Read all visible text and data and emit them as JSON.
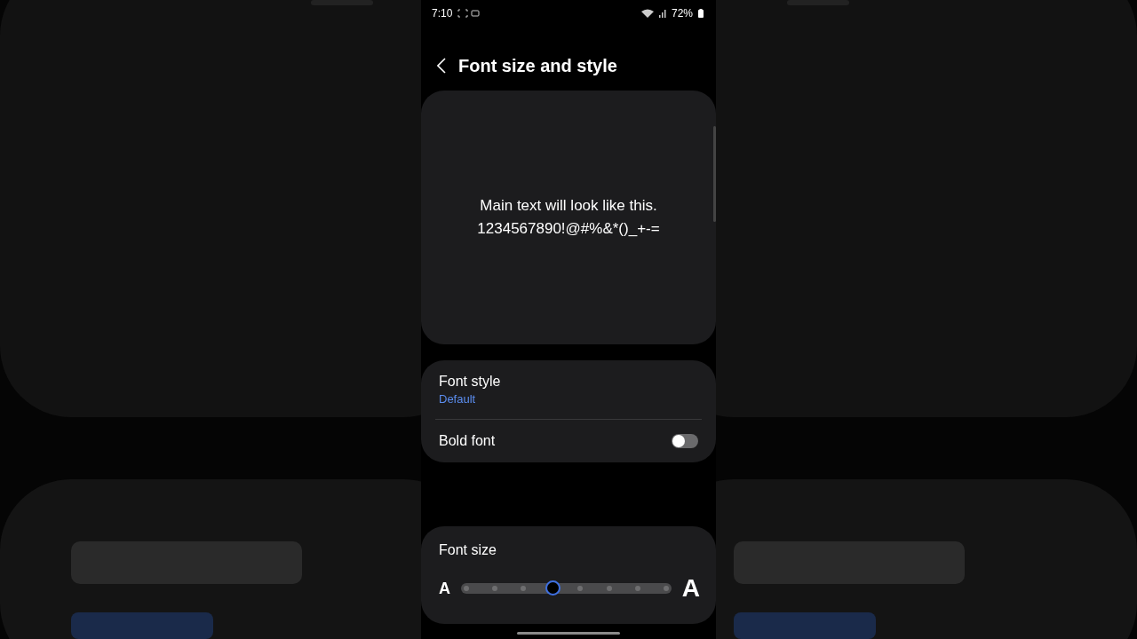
{
  "status_bar": {
    "time": "7:10",
    "battery": "72%"
  },
  "header": {
    "title": "Font size and style"
  },
  "preview": {
    "lines": [
      "Main text will look like this.",
      "1234567890!@#%&*()_+-="
    ]
  },
  "settings": [
    {
      "kind": "value",
      "label": "Font style",
      "value": "Default"
    },
    {
      "kind": "toggle",
      "label": "Bold font",
      "on": false
    }
  ],
  "font_size": {
    "label": "Font size",
    "small_glyph": "A",
    "large_glyph": "A",
    "level": 0.43
  }
}
